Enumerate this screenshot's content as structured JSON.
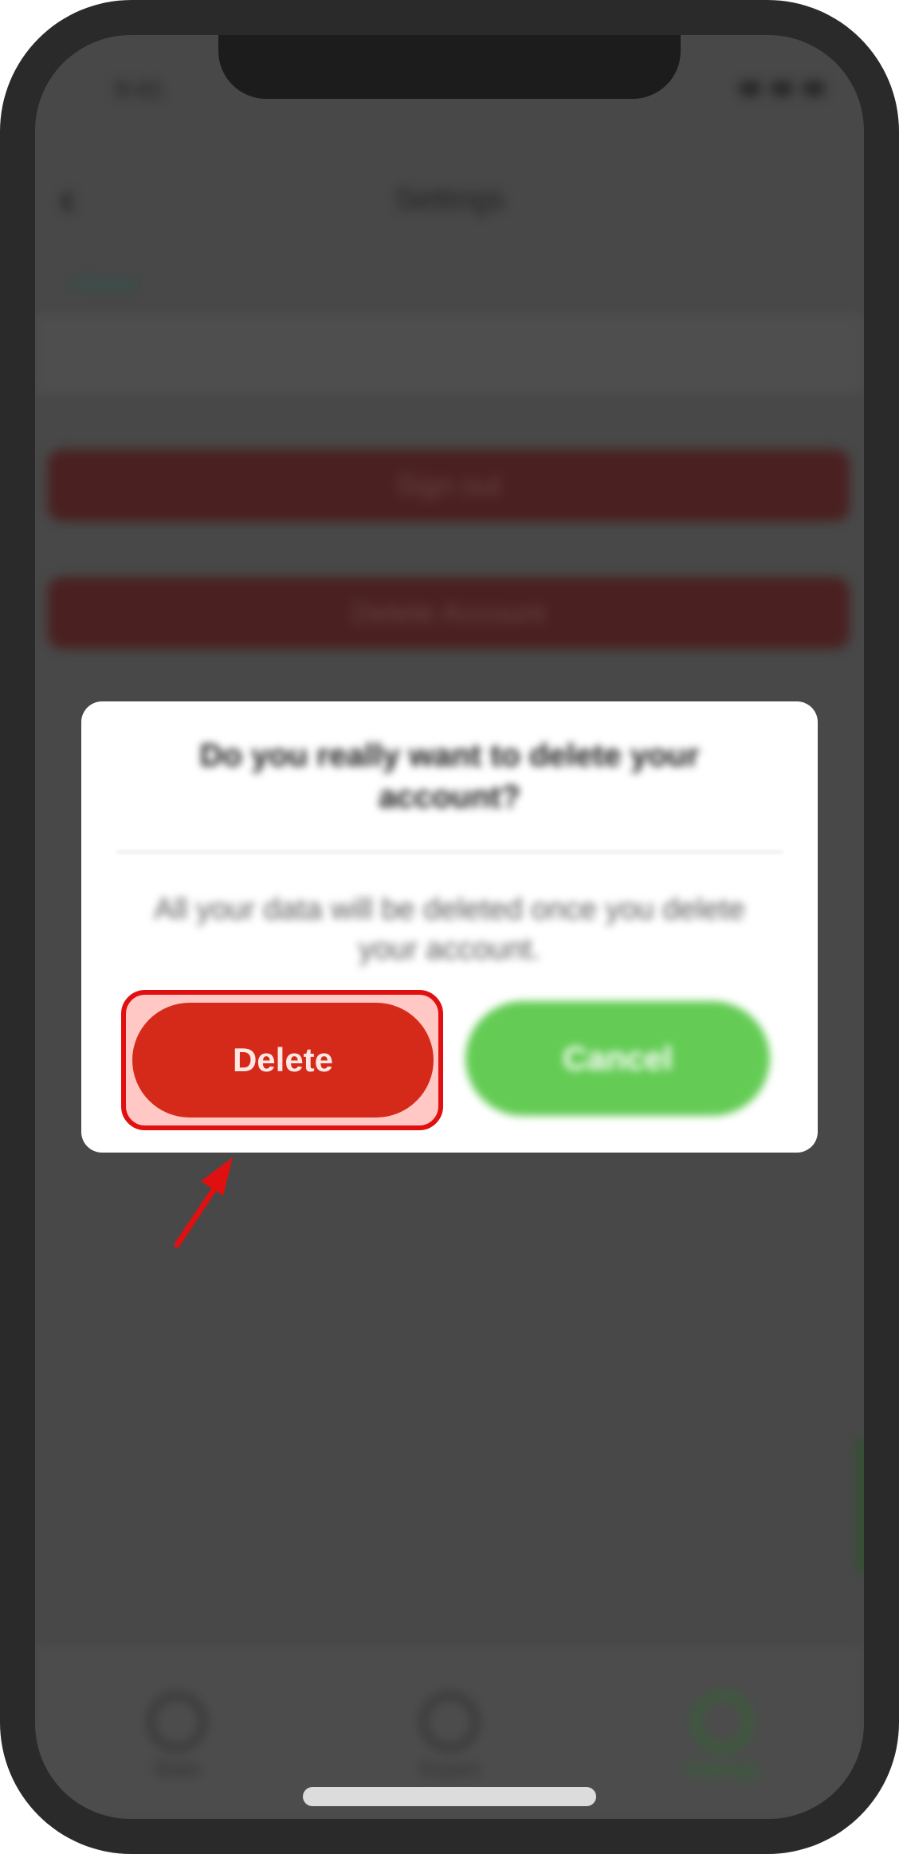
{
  "status_bar": {
    "time": "9:41"
  },
  "nav": {
    "back_icon": "chevron-left-icon",
    "title": "Settings"
  },
  "settings": {
    "section_label": "Home",
    "sign_out_label": "Sign out",
    "delete_account_label": "Delete Account"
  },
  "dialog": {
    "title": "Do you really want to delete your account?",
    "message": "All your data will be deleted once you delete your account.",
    "delete_label": "Delete",
    "cancel_label": "Cancel"
  },
  "tab_bar": {
    "items": [
      {
        "label": "Stats",
        "icon": "chart-icon"
      },
      {
        "label": "Export",
        "icon": "search-icon"
      },
      {
        "label": "Settings",
        "icon": "gear-icon"
      }
    ],
    "active_index": 2
  },
  "colors": {
    "delete": "#d52a1a",
    "cancel": "#64cc55",
    "highlight_border": "#e01010",
    "highlight_fill": "#ffc8c4",
    "active_tab": "#2d6a2d"
  }
}
